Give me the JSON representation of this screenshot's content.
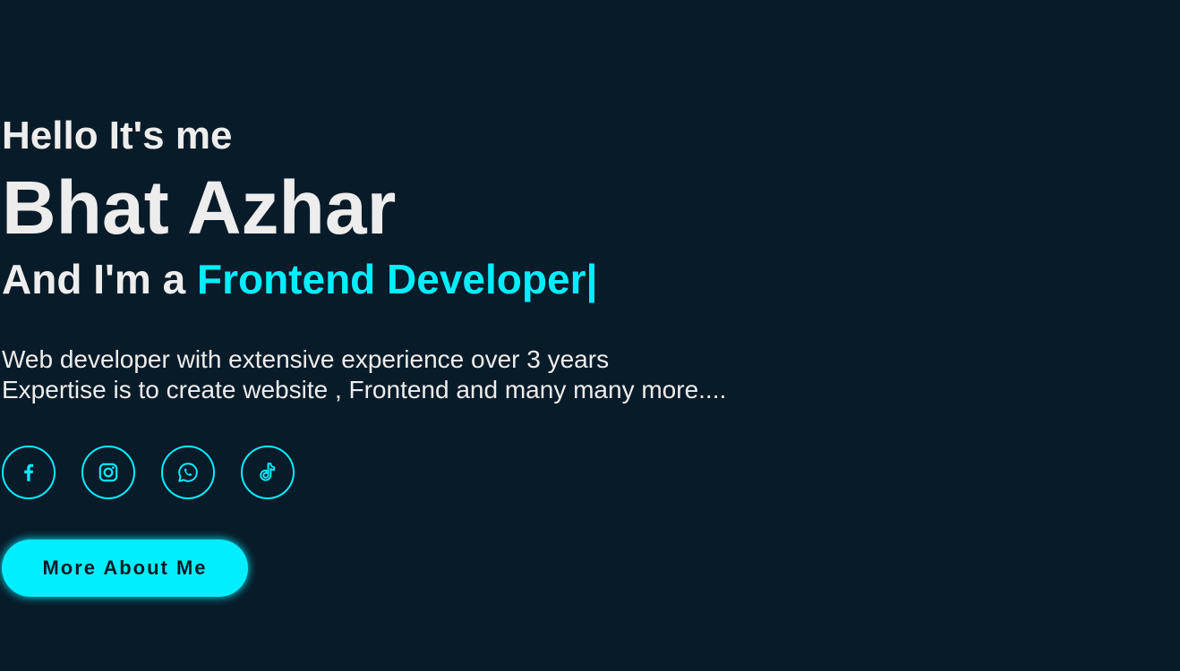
{
  "hero": {
    "greeting": "Hello It's me",
    "name": "Bhat Azhar",
    "role_prefix": "And I'm a ",
    "role_highlight": "Frontend Developer",
    "role_caret": "|",
    "description_line1": "Web developer with extensive experience over 3 years",
    "description_line2": "Expertise is to create website , Frontend and many many more....",
    "cta_label": "More About Me"
  },
  "social_links": [
    {
      "icon": "facebook-icon"
    },
    {
      "icon": "instagram-icon"
    },
    {
      "icon": "whatsapp-icon"
    },
    {
      "icon": "tiktok-icon"
    }
  ],
  "colors": {
    "background": "#081b29",
    "text": "#ededed",
    "accent": "#00eeff"
  }
}
